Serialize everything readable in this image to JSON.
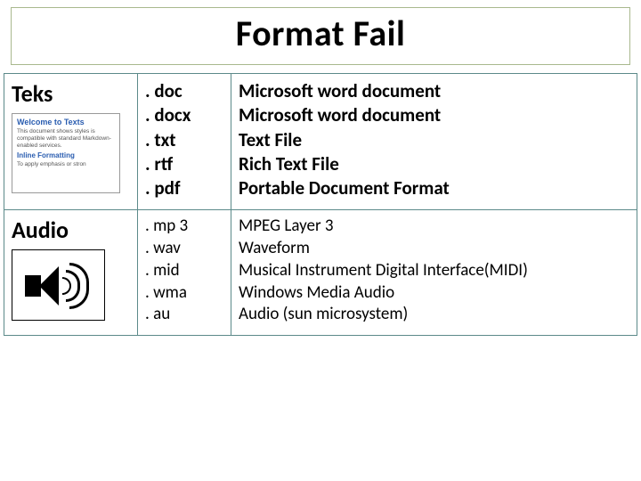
{
  "title": "Format Fail",
  "rows": [
    {
      "category": "Teks",
      "thumb": {
        "h1": "Welcome to Texts",
        "p1": "This document shows styles is compatible with standard Markdown-enabled services.",
        "h2": "Inline Formatting",
        "p2": "To apply emphasis or stron"
      },
      "ext": [
        ". doc",
        ". docx",
        ". txt",
        ". rtf",
        ". pdf"
      ],
      "desc": [
        "Microsoft word document",
        "Microsoft word document",
        "Text File",
        "Rich Text File",
        "Portable Document Format"
      ]
    },
    {
      "category": "Audio",
      "ext": [
        ". mp 3",
        ". wav",
        ". mid",
        ". wma",
        ". au"
      ],
      "desc": [
        "MPEG Layer 3",
        "Waveform",
        "Musical Instrument Digital Interface(MIDI)",
        "Windows Media Audio",
        "Audio (sun microsystem)"
      ]
    }
  ]
}
